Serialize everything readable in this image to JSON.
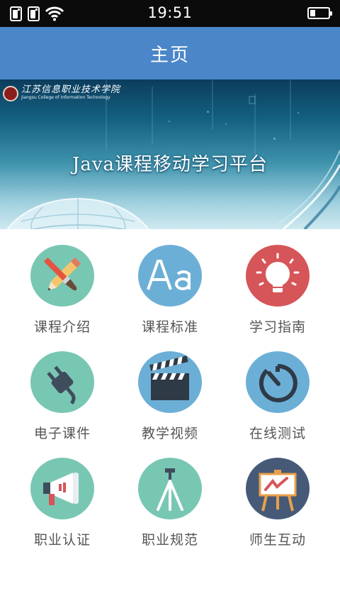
{
  "status_bar": {
    "time": "19:51"
  },
  "header": {
    "title": "主页"
  },
  "banner": {
    "title": "Java课程移动学习平台",
    "school_name_cn": "江苏信息职业技术学院",
    "school_name_en": "Jiangsu College of Information Technology"
  },
  "menu": [
    {
      "label": "课程介绍",
      "icon": "pencil-brush-icon",
      "color": "#78c7b3"
    },
    {
      "label": "课程标准",
      "icon": "font-aa-icon",
      "color": "#6cafd6"
    },
    {
      "label": "学习指南",
      "icon": "lightbulb-icon",
      "color": "#d65558"
    },
    {
      "label": "电子课件",
      "icon": "plug-icon",
      "color": "#78c7b3"
    },
    {
      "label": "教学视频",
      "icon": "clapperboard-icon",
      "color": "#6cafd6"
    },
    {
      "label": "在线测试",
      "icon": "timer-icon",
      "color": "#6cafd6"
    },
    {
      "label": "职业认证",
      "icon": "megaphone-icon",
      "color": "#78c7b3"
    },
    {
      "label": "职业规范",
      "icon": "tripod-icon",
      "color": "#78c7b3"
    },
    {
      "label": "师生互动",
      "icon": "easel-chart-icon",
      "color": "#465a78"
    }
  ]
}
